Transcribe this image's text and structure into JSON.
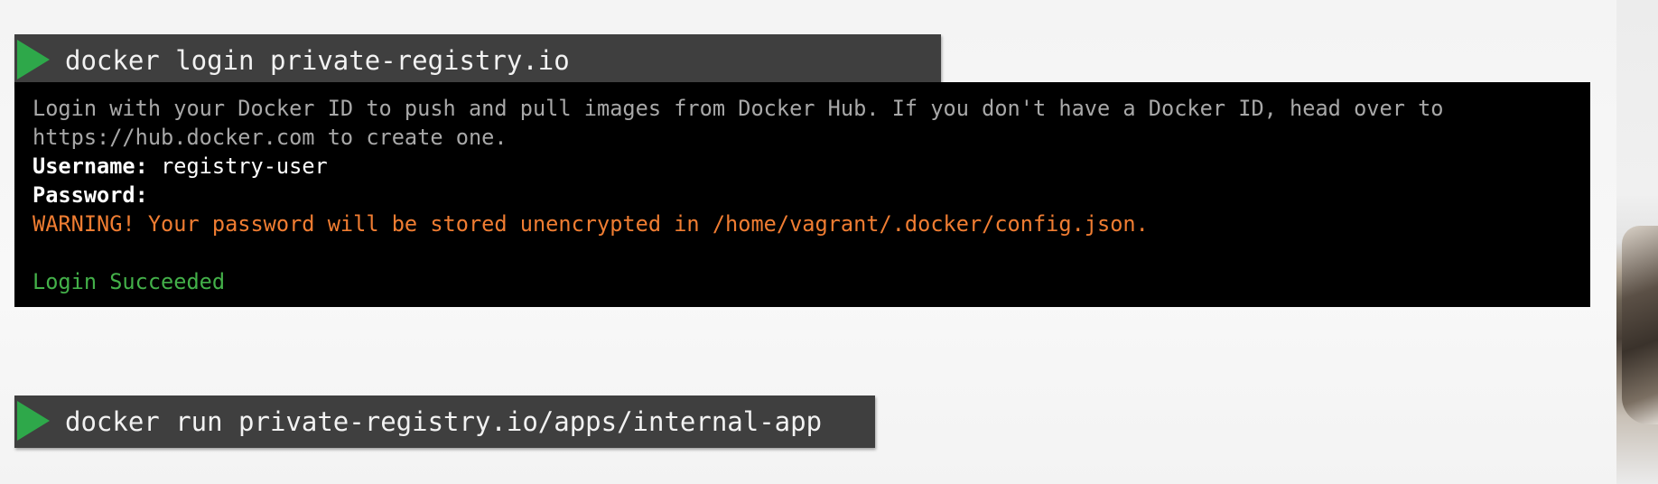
{
  "commands": {
    "login": "docker login private-registry.io",
    "run": "docker run private-registry.io/apps/internal-app"
  },
  "terminal": {
    "intro_line1": "Login with your Docker ID to push and pull images from Docker Hub. If you don't have a Docker ID, head over to",
    "intro_line2": "https://hub.docker.com to create one.",
    "username_label": "Username:",
    "username_value": "registry-user",
    "password_label": "Password:",
    "warning": "WARNING! Your password will be stored unencrypted in /home/vagrant/.docker/config.json.",
    "success": "Login Succeeded"
  },
  "colors": {
    "play_icon": "#2ea84a",
    "command_bar": "#3f3f3f",
    "terminal_bg": "#000000",
    "warning_text": "#f07d32",
    "success_text": "#43b049"
  },
  "icons": {
    "command_marker": "play-icon"
  }
}
